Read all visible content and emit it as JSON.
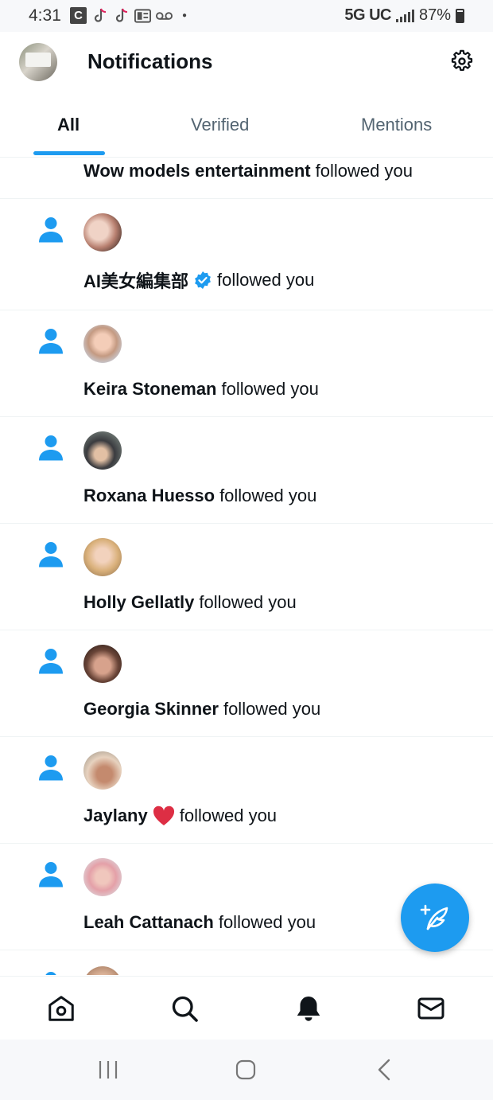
{
  "status_bar": {
    "time": "4:31",
    "c_badge": "C",
    "network": "5G UC",
    "battery": "87%",
    "icons": [
      "c-icon",
      "tiktok-icon",
      "tiktok-icon",
      "news-icon",
      "voicemail-icon",
      "dot-icon"
    ]
  },
  "header": {
    "title": "Notifications",
    "settings_icon": "gear-icon"
  },
  "tabs": [
    {
      "label": "All",
      "active": true
    },
    {
      "label": "Verified",
      "active": false
    },
    {
      "label": "Mentions",
      "active": false
    }
  ],
  "notifications": [
    {
      "name": "Wow models entertainment",
      "action": "followed you"
    },
    {
      "name": "AI美女編集部",
      "action": "followed you",
      "verified": true
    },
    {
      "name": "Keira Stoneman",
      "action": "followed you"
    },
    {
      "name": "Roxana Huesso",
      "action": "followed you"
    },
    {
      "name": "Holly Gellatly",
      "action": "followed you"
    },
    {
      "name": "Georgia Skinner",
      "action": "followed you"
    },
    {
      "name": "Jaylany",
      "action": "followed you",
      "emoji": "heart"
    },
    {
      "name": "Leah Cattanach",
      "action": "followed you"
    }
  ],
  "fab": {
    "icon": "compose-icon"
  },
  "bottom_nav": [
    "home-icon",
    "search-icon",
    "bell-icon",
    "mail-icon"
  ],
  "colors": {
    "accent": "#1d9bf0",
    "text": "#0f1419",
    "muted": "#536471",
    "heart": "#e0245e"
  }
}
